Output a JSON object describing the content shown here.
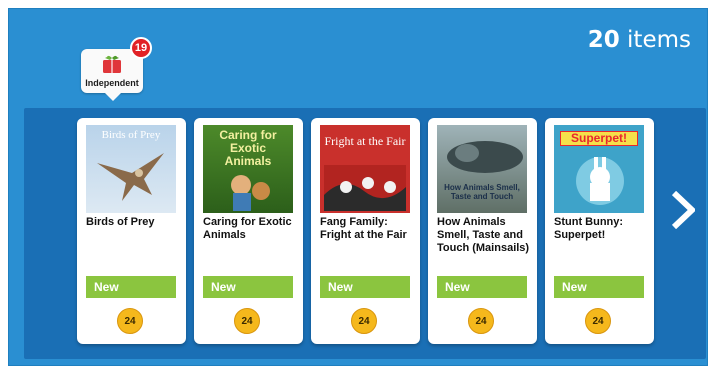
{
  "header": {
    "items_count": "20",
    "items_label": "items"
  },
  "shelf_badge": {
    "label": "Independent",
    "count": "19",
    "icon": "book-icon"
  },
  "books": [
    {
      "title": "Birds of Prey",
      "cover_text": "Birds of Prey",
      "status": "New",
      "level": "24"
    },
    {
      "title": "Caring for Exotic Animals",
      "cover_text": "Caring for Exotic Animals",
      "status": "New",
      "level": "24"
    },
    {
      "title": "Fang Family: Fright at the Fair",
      "cover_text": "Fright at the Fair",
      "status": "New",
      "level": "24"
    },
    {
      "title": "How Animals Smell, Taste and Touch (Mainsails)",
      "cover_text": "How Animals Smell, Taste and Touch",
      "status": "New",
      "level": "24"
    },
    {
      "title": "Stunt Bunny: Superpet!",
      "cover_text": "Superpet!",
      "status": "New",
      "level": "24"
    }
  ],
  "navigation": {
    "next_icon": "chevron-right-icon"
  },
  "colors": {
    "background": "#2a8fd2",
    "shelf": "#1a6fb5",
    "new_badge": "#8bc53f",
    "level_badge": "#f5b81c",
    "count_badge": "#e12226"
  }
}
